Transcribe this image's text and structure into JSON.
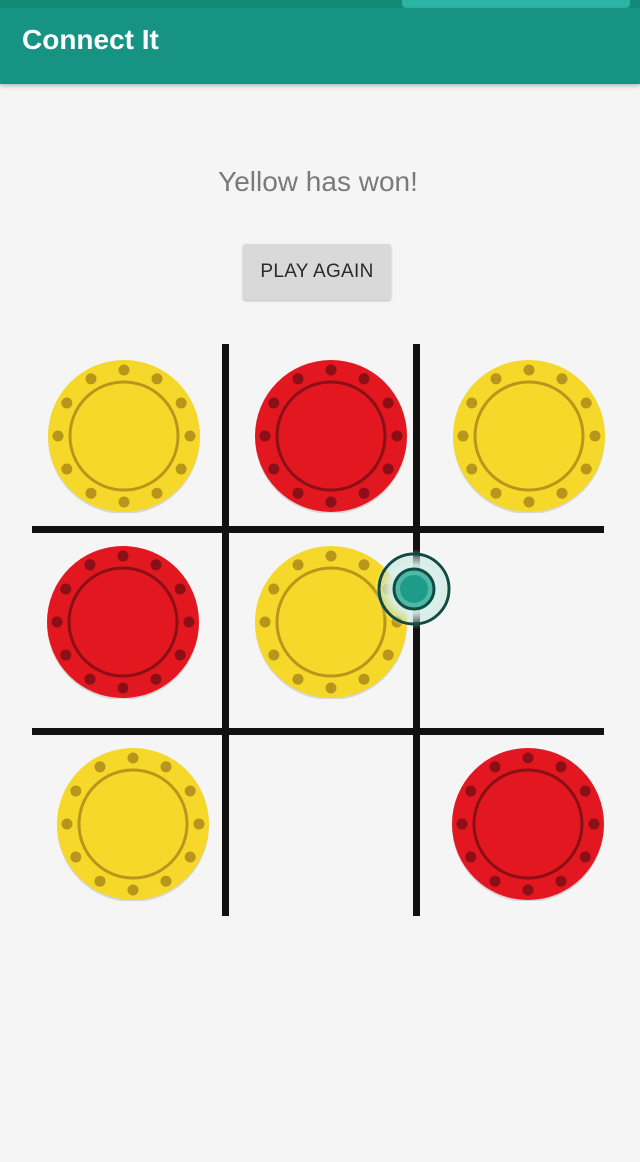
{
  "app": {
    "title": "Connect It"
  },
  "game": {
    "status": "Yellow has won!",
    "play_again_label": "PLAY AGAIN",
    "board": [
      [
        "yellow",
        "red",
        "yellow"
      ],
      [
        "red",
        "yellow",
        ""
      ],
      [
        "yellow",
        "",
        "red"
      ]
    ]
  },
  "colors": {
    "app_bar": "#169383",
    "status_bar": "#138a78",
    "yellow_chip": "#f5d829",
    "yellow_ring": "#b8961c",
    "red_chip": "#e3171f",
    "red_ring": "#8a0f16",
    "touch_indicator": "#1e9c8a"
  }
}
